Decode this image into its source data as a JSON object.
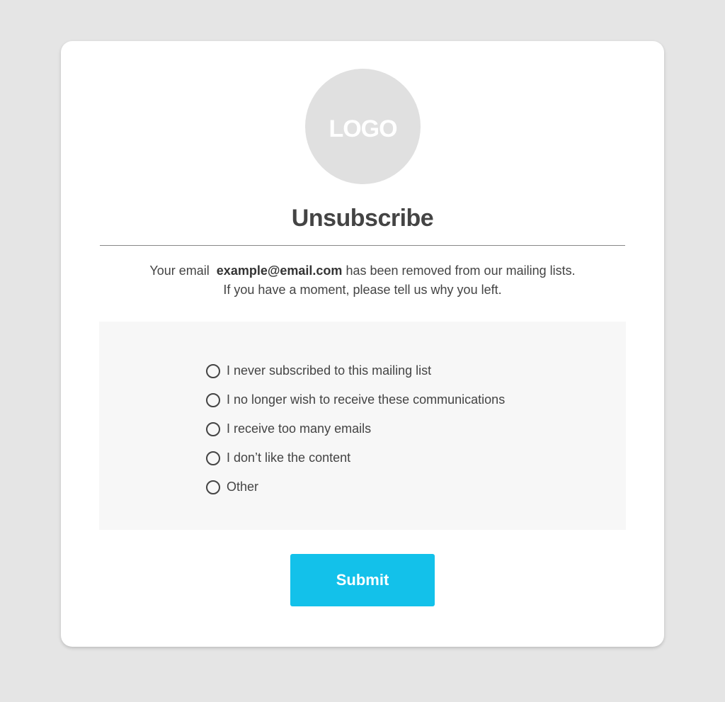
{
  "logo": {
    "text": "LOGO"
  },
  "title": "Unsubscribe",
  "message": {
    "prefix": "Your email",
    "email": "example@email.com",
    "suffix": "has been removed from our mailing lists.",
    "line2": "If you have a moment, please tell us why you left."
  },
  "reasons": [
    {
      "label": "I never subscribed to this mailing list",
      "checked": false
    },
    {
      "label": "I no longer wish to receive these communications",
      "checked": false
    },
    {
      "label": "I receive too many emails",
      "checked": false
    },
    {
      "label": "I don’t like the content",
      "checked": false
    },
    {
      "label": "Other",
      "checked": false
    }
  ],
  "submit": {
    "label": "Submit"
  },
  "colors": {
    "background": "#e5e5e5",
    "card": "#ffffff",
    "logo_circle": "#e0e0e0",
    "text": "#444444",
    "panel": "#f7f7f7",
    "accent": "#13c1ea"
  }
}
